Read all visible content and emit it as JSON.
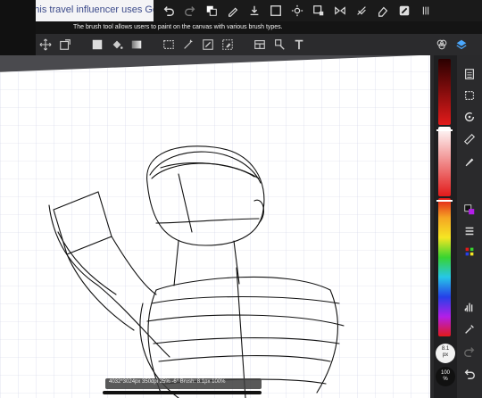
{
  "article": {
    "text": "how this travel influencer uses Go"
  },
  "tooltip": {
    "text": "The brush tool allows users to paint on the canvas with various brush types."
  },
  "top_toolbar": {
    "icons": [
      "undo-icon",
      "redo-icon",
      "color-swatch-icon",
      "brush-icon",
      "import-icon",
      "select-icon",
      "adjust-icon",
      "transform-icon",
      "flip-icon",
      "no-snap-icon",
      "eraser-icon",
      "app-icon",
      "more-icon"
    ]
  },
  "second_toolbar": {
    "icons": [
      "move-icon",
      "crop-icon",
      "fill-rect-icon",
      "fill-bucket-icon",
      "gradient-icon",
      "rect-select-icon",
      "magic-wand-icon",
      "pen-select-icon",
      "eraser-select-icon",
      "panel-icon",
      "stamp-icon",
      "text-icon",
      "blend-icon",
      "layers-icon"
    ]
  },
  "right_panel": {
    "icons": [
      "pages-icon",
      "selection-icon",
      "rotate-icon",
      "ruler-icon",
      "fill-icon",
      "color-icon",
      "menu-icon",
      "palette-icon",
      "hand-icon",
      "eyedropper-icon",
      "redo-icon",
      "undo-icon"
    ]
  },
  "brush_size": {
    "value": "8.1",
    "unit": "px"
  },
  "brush_opacity": {
    "value": "100",
    "unit": "%"
  },
  "status": {
    "text": "4032*3024px 350dpi 25% -6° Brush: 8.1px 100%"
  },
  "colors": {
    "accent": "#4aa8ff",
    "primary_red": "#e21a1a",
    "canvas": "#ffffff"
  }
}
